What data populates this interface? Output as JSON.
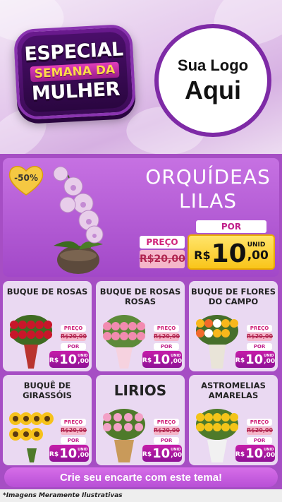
{
  "header": {
    "badge_line1": "ESPECIAL",
    "badge_line2": "SEMANA DA",
    "badge_line3": "MULHER",
    "logo_line1": "Sua Logo",
    "logo_line2": "Aqui"
  },
  "featured": {
    "discount": "-50%",
    "title_line1": "ORQUÍDEAS",
    "title_line2": "LILAS",
    "preco_label": "PREÇO",
    "old_price": "R$20,00",
    "por_label": "POR",
    "currency": "R$",
    "price_int": "10",
    "price_dec": ",00",
    "unit": "UNID",
    "image_icon": "orchid-plant-icon"
  },
  "products": [
    {
      "title": "BUQUE DE ROSAS",
      "preco_label": "PREÇO",
      "old_price": "R$20,00",
      "por_label": "POR",
      "currency": "R$",
      "price_int": "10",
      "price_dec": ",00",
      "unit": "UNID",
      "image_icon": "red-rose-bouquet-icon"
    },
    {
      "title": "BUQUE DE ROSAS ROSAS",
      "preco_label": "PREÇO",
      "old_price": "R$20,00",
      "por_label": "POR",
      "currency": "R$",
      "price_int": "10",
      "price_dec": ",00",
      "unit": "UNID",
      "image_icon": "pink-rose-bouquet-icon"
    },
    {
      "title": "BUQUE DE FLORES DO CAMPO",
      "preco_label": "PREÇO",
      "old_price": "R$20,00",
      "por_label": "POR",
      "currency": "R$",
      "price_int": "10",
      "price_dec": ",00",
      "unit": "UNID",
      "image_icon": "wildflower-bouquet-icon"
    },
    {
      "title": "BUQUÊ DE GIRASSÓIS",
      "preco_label": "PREÇO",
      "old_price": "R$20,00",
      "por_label": "POR",
      "currency": "R$",
      "price_int": "10",
      "price_dec": ",00",
      "unit": "UNID",
      "image_icon": "sunflower-bouquet-icon"
    },
    {
      "title": "LIRIOS",
      "preco_label": "PREÇO",
      "old_price": "R$20,00",
      "por_label": "POR",
      "currency": "R$",
      "price_int": "10",
      "price_dec": ",00",
      "unit": "UNID",
      "image_icon": "lily-bouquet-icon"
    },
    {
      "title": "ASTROMELIAS AMARELAS",
      "preco_label": "PREÇO",
      "old_price": "R$20,00",
      "por_label": "POR",
      "currency": "R$",
      "price_int": "10",
      "price_dec": ",00",
      "unit": "UNID",
      "image_icon": "yellow-alstroemeria-bouquet-icon"
    }
  ],
  "cta": "Crie seu encarte com este tema!",
  "disclaimer": "*Imagens Meramente Ilustrativas",
  "colors": {
    "accent": "#a64ec4",
    "badge": "#4a0e6a",
    "price_yellow": "#f9c51a",
    "price_magenta": "#c61ea9"
  }
}
